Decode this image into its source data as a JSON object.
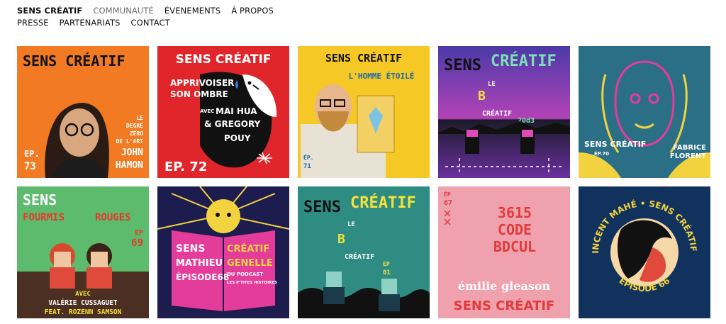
{
  "nav": {
    "brand": "SENS CRÉATIF",
    "row1": [
      "COMMUNAUTÉ",
      "ÉVENEMENTS",
      "À PROPOS"
    ],
    "row2": [
      "PRESSE",
      "PARTENARIATS",
      "CONTACT"
    ]
  },
  "colors": {
    "tile1_bg": "#f17a22",
    "tile2_bg": "#e0262b",
    "tile3_bg": "#f6c825",
    "tile4_bg": "#8b3fb8",
    "tile5_bg": "#2b6f86",
    "tile6_bg": "#5dbb6d",
    "tile7_bg": "#1d1c4f",
    "tile8_bg": "#2e8c83",
    "tile9_bg": "#f0a1ae",
    "tile10_bg": "#10325c"
  },
  "episodes": [
    {
      "title": "SENS CRÉATIF",
      "lines": [
        "LE",
        "DEGRÉ",
        "ZÉRO",
        "DE L'ART",
        "JOHN",
        "HAMON"
      ],
      "ep_label": "EP.",
      "ep_num": "73"
    },
    {
      "title": "SENS CRÉATIF",
      "lines": [
        "APPRIVOISER",
        "SON OMBRE",
        "AVEC",
        "MAI HUA",
        "& GREGORY",
        "POUY"
      ],
      "ep": "EP. 72"
    },
    {
      "title": "SENS CRÉATIF",
      "subtitle": "L'HOMME ÉTOILÉ",
      "ep_label": "ÉP.",
      "ep_num": "71"
    },
    {
      "title_a": "SENS",
      "title_b": "CRÉATIF",
      "le": "LE",
      "b": "B",
      "creatif": "CRÉATIF",
      "year": "20d3"
    },
    {
      "title": "SENS CRÉATIF",
      "ep": "ÉP.70",
      "guest": [
        "FABRICE",
        "FLORENT"
      ]
    },
    {
      "title_a": "SENS",
      "title_b": "FOURMIS",
      "title_c": "ROUGES",
      "ep_label": "EP",
      "ep_num": "69",
      "avec": "AVEC",
      "guest1": "VALÉRIE CUSSAGUET",
      "guest2": "FEAT. ROZENN SAMSON"
    },
    {
      "lines_left": [
        "SENS",
        "MATHIEU",
        "ÉPISODE68"
      ],
      "lines_right": [
        "CRÉATIF",
        "GENELLE",
        "DU PODCAST",
        "LES P'TITES HISTOIRES"
      ]
    },
    {
      "title_a": "SENS",
      "title_b": "CRÉATIF",
      "le": "LE",
      "b": "B",
      "creatif": "CRÉATIF",
      "ep_label": "EP",
      "ep_num": "01"
    },
    {
      "ep_label": "ÉP",
      "ep_num": "67",
      "lines": [
        "3615",
        "CODE",
        "BDCUL"
      ],
      "guest": "émilie gleason",
      "title": "SENS CRÉATIF"
    },
    {
      "ring_top": "VINCENT MAHÉ • SENS CRÉATIF •",
      "ring_bottom": "ÉPISODE 66"
    }
  ]
}
